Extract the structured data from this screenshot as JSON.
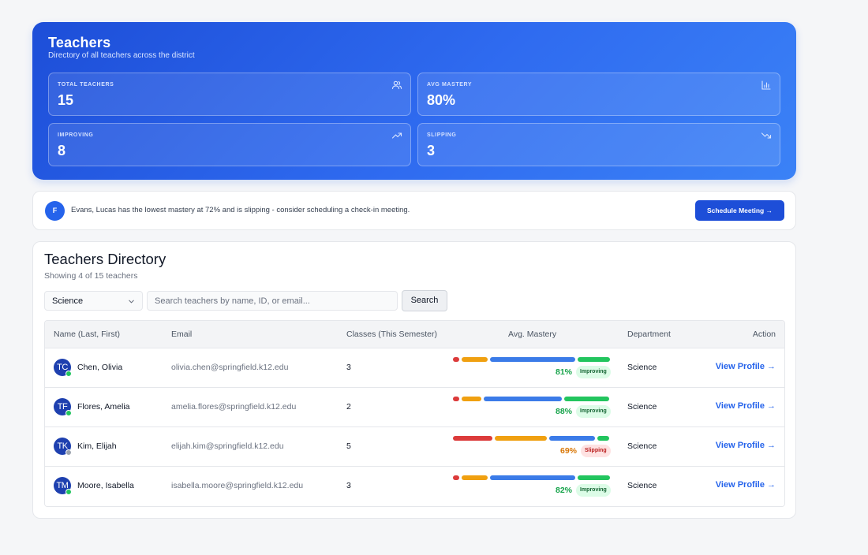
{
  "hero": {
    "title": "Teachers",
    "subtitle": "Directory of all teachers across the district",
    "stats": [
      {
        "label": "TOTAL TEACHERS",
        "value": "15",
        "icon": "users-icon"
      },
      {
        "label": "AVG MASTERY",
        "value": "80%",
        "icon": "bar-chart-icon"
      },
      {
        "label": "IMPROVING",
        "value": "8",
        "icon": "trending-up-icon"
      },
      {
        "label": "SLIPPING",
        "value": "3",
        "icon": "trending-down-icon"
      }
    ]
  },
  "alert": {
    "avatar_initial": "F",
    "message": "Evans, Lucas has the lowest mastery at 72% and is slipping - consider scheduling a check-in meeting.",
    "button_label": "Schedule Meeting →"
  },
  "directory": {
    "title": "Teachers Directory",
    "subtitle": "Showing 4 of 15 teachers",
    "department_filter": "Science",
    "search_placeholder": "Search teachers by name, ID, or email...",
    "search_button": "Search",
    "columns": [
      "Name (Last, First)",
      "Email",
      "Classes (This Semester)",
      "Avg. Mastery",
      "Department",
      "Action"
    ],
    "rows": [
      {
        "initials": "TC",
        "online": true,
        "name": "Chen, Olivia",
        "email": "olivia.chen@springfield.k12.edu",
        "classes": "3",
        "mastery_segments": [
          4,
          17,
          56,
          21
        ],
        "mastery": "81%",
        "trend": "Improving",
        "department": "Science",
        "action": "View Profile →"
      },
      {
        "initials": "TF",
        "online": true,
        "name": "Flores, Amelia",
        "email": "amelia.flores@springfield.k12.edu",
        "classes": "2",
        "mastery_segments": [
          4,
          13,
          52,
          30
        ],
        "mastery": "88%",
        "trend": "Improving",
        "department": "Science",
        "action": "View Profile →"
      },
      {
        "initials": "TK",
        "online": false,
        "name": "Kim, Elijah",
        "email": "elijah.kim@springfield.k12.edu",
        "classes": "5",
        "mastery_segments": [
          26,
          34,
          30,
          8
        ],
        "mastery": "69%",
        "trend": "Slipping",
        "department": "Science",
        "action": "View Profile →"
      },
      {
        "initials": "TM",
        "online": true,
        "name": "Moore, Isabella",
        "email": "isabella.moore@springfield.k12.edu",
        "classes": "3",
        "mastery_segments": [
          4,
          17,
          56,
          21
        ],
        "mastery": "82%",
        "trend": "Improving",
        "department": "Science",
        "action": "View Profile →"
      }
    ]
  },
  "colors": {
    "accent": "#2563eb",
    "segment_colors": [
      "#dc3b3b",
      "#f0a010",
      "#3b7be8",
      "#22c55e"
    ],
    "pct_improving": "#16a34a",
    "pct_slipping": "#d97706",
    "online": "#22c55e",
    "offline": "#9ca3af"
  }
}
